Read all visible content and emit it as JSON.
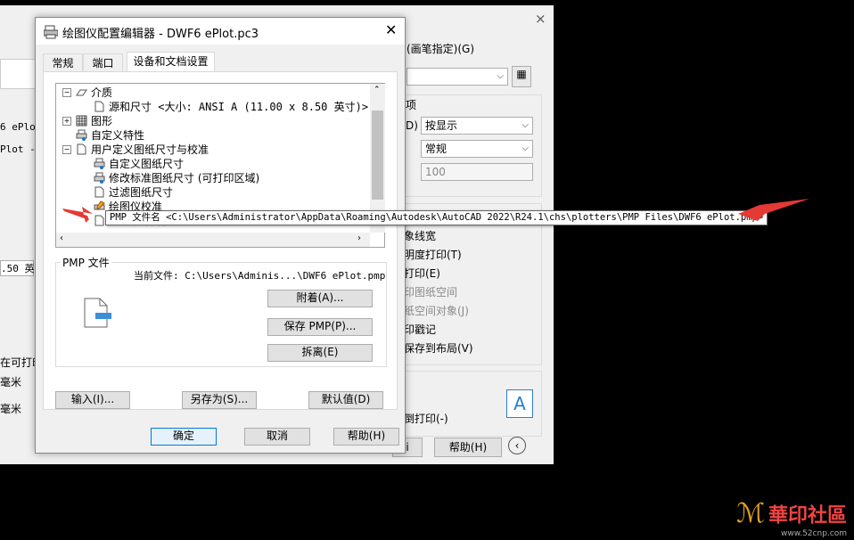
{
  "bg": {
    "pen_assign": "(画笔指定)(G)",
    "opt_label": "项",
    "opt_prefix": "D)",
    "combo1": "按显示",
    "combo2": "常规",
    "field_val": "100",
    "left_lines": [
      "6 ePlo",
      "Plot -",
      ".50 英寸"
    ],
    "left_bottom": [
      "在可打印",
      "毫米",
      "毫米"
    ],
    "right_opts": [
      "象线宽",
      "明度打印(T)",
      "打印(E)",
      "印图纸空间",
      "纸空间对象(J)",
      "印戳记",
      "保存到布局(V)"
    ],
    "reverse": "倒打印(-)",
    "ok_stub": "i",
    "help": "帮助(H)",
    "preview_letter": "A",
    "close": "×"
  },
  "dialog": {
    "title": "绘图仪配置编辑器 - DWF6 ePlot.pc3",
    "close": "✕",
    "tabs": [
      "常规",
      "端口",
      "设备和文档设置"
    ],
    "tree": [
      {
        "label": "介质",
        "indent": 0,
        "pm": "−"
      },
      {
        "label": "源和尺寸 <大小: ANSI A (11.00 x 8.50 英寸)>",
        "indent": 1
      },
      {
        "label": "图形",
        "indent": 0,
        "pm": "+"
      },
      {
        "label": "自定义特性",
        "indent": 0
      },
      {
        "label": "用户定义图纸尺寸与校准",
        "indent": 0,
        "pm": "−"
      },
      {
        "label": "自定义图纸尺寸",
        "indent": 1
      },
      {
        "label": "修改标准图纸尺寸 (可打印区域)",
        "indent": 1
      },
      {
        "label": "过滤图纸尺寸",
        "indent": 1
      },
      {
        "label": "绘图仪校准",
        "indent": 1
      },
      {
        "label": "PMP 文件名",
        "indent": 1
      }
    ],
    "tooltip": "PMP 文件名 <C:\\Users\\Administrator\\AppData\\Roaming\\Autodesk\\AutoCAD 2022\\R24.1\\chs\\plotters\\PMP Files\\DWF6 ePlot.pmp>",
    "pmp_group": "PMP 文件",
    "current_file": "当前文件: C:\\Users\\Adminis...\\DWF6 ePlot.pmp",
    "attach": "附着(A)...",
    "save_pmp": "保存 PMP(P)...",
    "detach": "拆离(E)",
    "import": "输入(I)...",
    "save_as": "另存为(S)...",
    "defaults": "默认值(D)",
    "ok": "确定",
    "cancel": "取消",
    "help": "帮助(H)"
  },
  "watermark": {
    "brand": "華印社區",
    "url": "www.52cnp.com"
  },
  "colors": {
    "arrow": "#e53935",
    "accent": "#0078d7"
  }
}
